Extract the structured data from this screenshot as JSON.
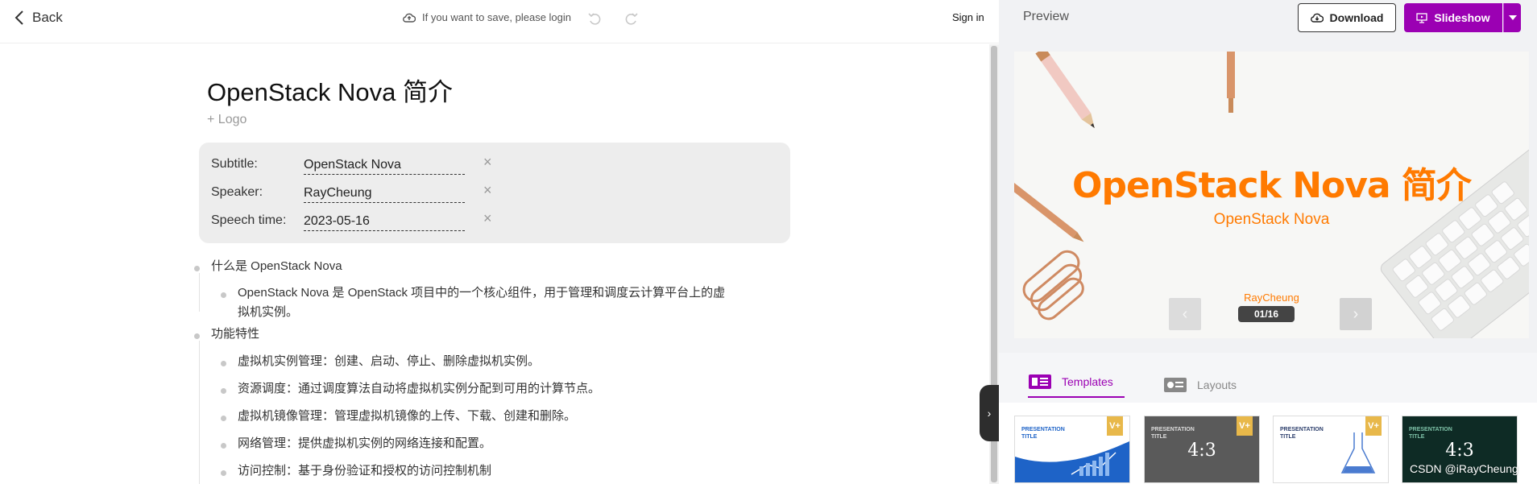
{
  "topbar": {
    "back_label": "Back",
    "save_hint": "If you want to save, please login",
    "signin_label": "Sign in"
  },
  "editor": {
    "title": "OpenStack Nova 简介",
    "add_logo": "+ Logo",
    "meta": {
      "subtitle_label": "Subtitle:",
      "subtitle_value": "OpenStack Nova",
      "speaker_label": "Speaker:",
      "speaker_value": "RayCheung",
      "time_label": "Speech time:",
      "time_value": "2023-05-16"
    },
    "outline": [
      "什么是 OpenStack Nova",
      "OpenStack Nova 是 OpenStack 项目中的一个核心组件，用于管理和调度云计算平台上的虚",
      "拟机实例。",
      "功能特性",
      "虚拟机实例管理：创建、启动、停止、删除虚拟机实例。",
      "资源调度：通过调度算法自动将虚拟机实例分配到可用的计算节点。",
      "虚拟机镜像管理：管理虚拟机镜像的上传、下载、创建和删除。",
      "网络管理：提供虚拟机实例的网络连接和配置。",
      "访问控制：基于身份验证和授权的访问控制机制"
    ]
  },
  "panel": {
    "title": "Preview",
    "download_label": "Download",
    "slideshow_label": "Slideshow",
    "accent_color": "#9b00b3",
    "slide": {
      "title": "OpenStack Nova 简介",
      "subtitle": "OpenStack Nova",
      "speaker": "RayCheung",
      "counter": "01/16",
      "title_color": "#ff7a00"
    },
    "tabs": {
      "templates": "Templates",
      "layouts": "Layouts"
    },
    "thumbs": [
      {
        "title": "PRESENTATION\nTITLE",
        "badge": "V+"
      },
      {
        "title": "PRESENTATION\nTITLE",
        "badge": "V+",
        "ratio": "4:3"
      },
      {
        "title": "PRESENTATION\nTITLE",
        "badge": "V+"
      },
      {
        "title": "PRESENTATION\nTITLE",
        "ratio": "4:3"
      }
    ]
  },
  "watermark": "CSDN @iRayCheung"
}
